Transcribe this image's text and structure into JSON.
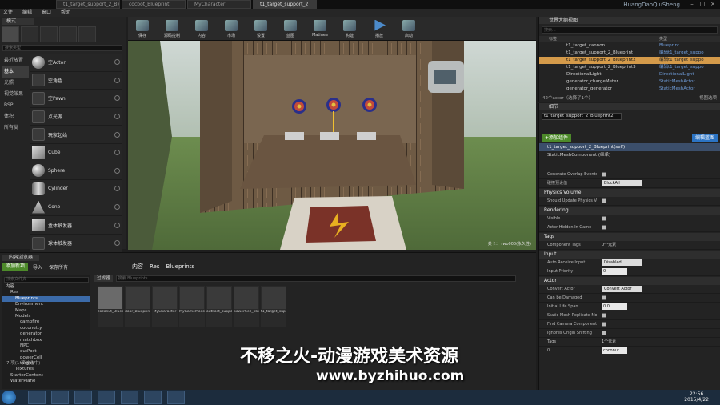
{
  "title_bar": {
    "tabs": [
      "t1_target_support_2_Bluepri",
      "cocbot_Blueprint",
      "MyCharacter",
      "t1_target_support_2"
    ],
    "username": "HuangDaoQiuSheng"
  },
  "menu": [
    "文件",
    "编辑",
    "窗口",
    "帮助"
  ],
  "modes": {
    "tab": "模式",
    "search": "搜索类型",
    "categories": [
      "最近放置",
      "基本",
      "光照",
      "视觉效果",
      "BSP",
      "体积",
      "所有类"
    ],
    "items": [
      "空Actor",
      "空角色",
      "空Pawn",
      "点光源",
      "玩家起始",
      "Cube",
      "Sphere",
      "Cylinder",
      "Cone",
      "盒体触发器",
      "球体触发器"
    ]
  },
  "toolbar": [
    "保存",
    "源码控制",
    "内容",
    "市场",
    "设置",
    "蓝图",
    "Matinee",
    "构建",
    "播放",
    "启动"
  ],
  "viewport": {
    "caption": "关卡：  rwo000(永久性)"
  },
  "outliner": {
    "tab": "世界大纲视图",
    "search": "搜索...",
    "col_label": "标签",
    "col_type": "类型",
    "rows": [
      {
        "label": "t1_target_cannon",
        "type": "Blueprint"
      },
      {
        "label": "t1_target_support_2_Blueprint",
        "type": "编辑t1_target_suppo"
      },
      {
        "label": "t1_target_support_2_Blueprint2",
        "type": "编辑t1_target_suppo",
        "sel": true
      },
      {
        "label": "t1_target_support_2_Blueprint3",
        "type": "编辑t1_target_suppo"
      },
      {
        "label": "DirectionalLight",
        "type": "DirectionalLight"
      },
      {
        "label": "generator_chargeMeter",
        "type": "StaticMeshActor"
      },
      {
        "label": "generator_generator",
        "type": "StaticMeshActor"
      }
    ],
    "footer": "42个actor（选择了1个）",
    "view_options": "视图选项"
  },
  "details": {
    "tab": "细节",
    "name": "t1_target_support_2_Blueprint2",
    "add_component": "+添加组件",
    "edit_blueprint": "编辑蓝图",
    "components": [
      "t1_target_support_2_Blueprint(self)",
      "StaticMeshComponent (继承)"
    ],
    "sections": [
      {
        "title": "",
        "props": [
          {
            "k": "Generate Overlap Events",
            "t": "chk"
          },
          {
            "k": "碰撞预设值",
            "t": "dd",
            "v": "BlockAll"
          }
        ]
      },
      {
        "title": "Physics Volume",
        "props": [
          {
            "k": "Should Update Physics Volume",
            "t": "chk"
          }
        ]
      },
      {
        "title": "Rendering",
        "props": [
          {
            "k": "Visible",
            "t": "chk"
          },
          {
            "k": "Actor Hidden In Game",
            "t": "chk"
          }
        ]
      },
      {
        "title": "Tags",
        "props": [
          {
            "k": "Component Tags",
            "t": "txt",
            "v": "0个元素"
          }
        ]
      },
      {
        "title": "Input",
        "props": [
          {
            "k": "Auto Receive Input",
            "t": "dd",
            "v": "Disabled"
          },
          {
            "k": "Input Priority",
            "t": "num",
            "v": "0"
          }
        ]
      },
      {
        "title": "Actor",
        "props": [
          {
            "k": "Convert Actor",
            "t": "dd",
            "v": "Convert Actor"
          },
          {
            "k": "Can be Damaged",
            "t": "chk"
          },
          {
            "k": "Initial Life Span",
            "t": "num",
            "v": "0.0"
          }
        ]
      },
      {
        "title": "",
        "props": [
          {
            "k": "Static Mesh Replicate Movement",
            "t": "chk"
          },
          {
            "k": "Find Camera Component when...",
            "t": "chk"
          },
          {
            "k": "Ignores Origin Shifting",
            "t": "chk"
          },
          {
            "k": "Tags",
            "t": "txt",
            "v": "1个元素"
          },
          {
            "k": "0",
            "t": "num",
            "v": "coconut"
          }
        ]
      }
    ]
  },
  "content_browser": {
    "tab": "内容浏览器",
    "add_new": "添加新项",
    "import": "导入",
    "save_all": "保存所有",
    "path": [
      "内容",
      "Res",
      "Blueprints"
    ],
    "tree_search": "搜索文件夹",
    "filter": "过滤器",
    "search": "搜索 Blueprints",
    "tree": [
      "内容",
      "Res",
      "Blueprints",
      "Environment",
      "Maps",
      "Models",
      "campfire",
      "coconutty",
      "generator",
      "matchbox",
      "NPC",
      "outPost",
      "powerCell",
      "target",
      "Textures",
      "StarterContent",
      "WaterPlane"
    ],
    "assets": [
      "coconut_Blueprint",
      "door_Blueprint",
      "MyCharacter",
      "MyGameMode",
      "outPost_support_Blueprint",
      "powerCell_Blueprint",
      "t1_target_support_2_Blueprint"
    ],
    "count": "7 项(1 项被选中)"
  },
  "watermark": {
    "line1": "不移之火-动漫游戏美术资源",
    "line2": "www.byzhihuo.com"
  },
  "taskbar": {
    "time": "22:56",
    "date": "2015/4/22"
  }
}
